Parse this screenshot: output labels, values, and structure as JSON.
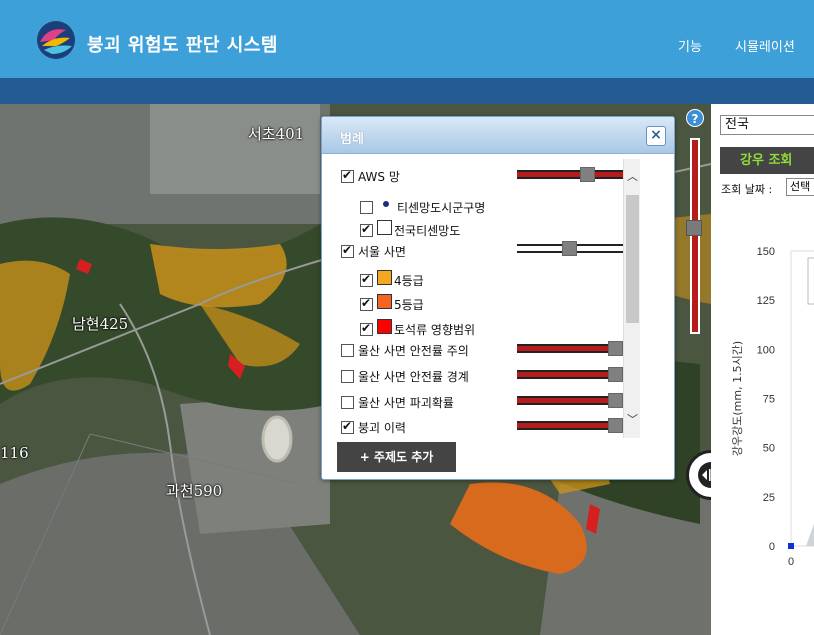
{
  "header": {
    "title": "붕괴 위험도 판단 시스템",
    "nav": [
      "기능",
      "시뮬레이션"
    ]
  },
  "map": {
    "places": [
      "서초401",
      "남현425",
      "116",
      "과천590"
    ]
  },
  "help": {
    "label": "?"
  },
  "legend": {
    "title": "범례",
    "close": "×",
    "layers": [
      {
        "label": "AWS 망",
        "checked": true
      },
      {
        "label": "티센망도시군구명",
        "checked": false
      },
      {
        "label": "전국티센망도",
        "checked": true
      },
      {
        "label": "서울 사면",
        "checked": true
      },
      {
        "label": "4등급",
        "checked": true,
        "color": "#f5a623"
      },
      {
        "label": "5등급",
        "checked": true,
        "color": "#f26522"
      },
      {
        "label": "토석류 영향범위",
        "checked": true,
        "color": "#ff0000"
      },
      {
        "label": "울산 사면 안전률 주의",
        "checked": false
      },
      {
        "label": "울산 사면 안전률 경계",
        "checked": false
      },
      {
        "label": "울산 사면 파괴확률",
        "checked": false
      },
      {
        "label": "붕괴 이력",
        "checked": true
      }
    ],
    "add_button": "+ 주제도 추가"
  },
  "right_panel": {
    "region": "전국",
    "rain_button": "강우 조회",
    "date_label": "조회 날짜 :",
    "date_value": "선택"
  },
  "chart_data": {
    "type": "line",
    "ylabel": "강우강도(mm, 1.5시간)",
    "yticks": [
      "150",
      "125",
      "100",
      "75",
      "50",
      "25",
      "0"
    ],
    "xticks": [
      "0"
    ],
    "ylim": [
      0,
      150
    ],
    "series": [
      {
        "x": [
          0
        ],
        "y": [
          0
        ]
      }
    ]
  },
  "colors": {
    "header": "#3ea0d8",
    "subbar": "#245a92",
    "accent_green": "#8fdc3a"
  }
}
